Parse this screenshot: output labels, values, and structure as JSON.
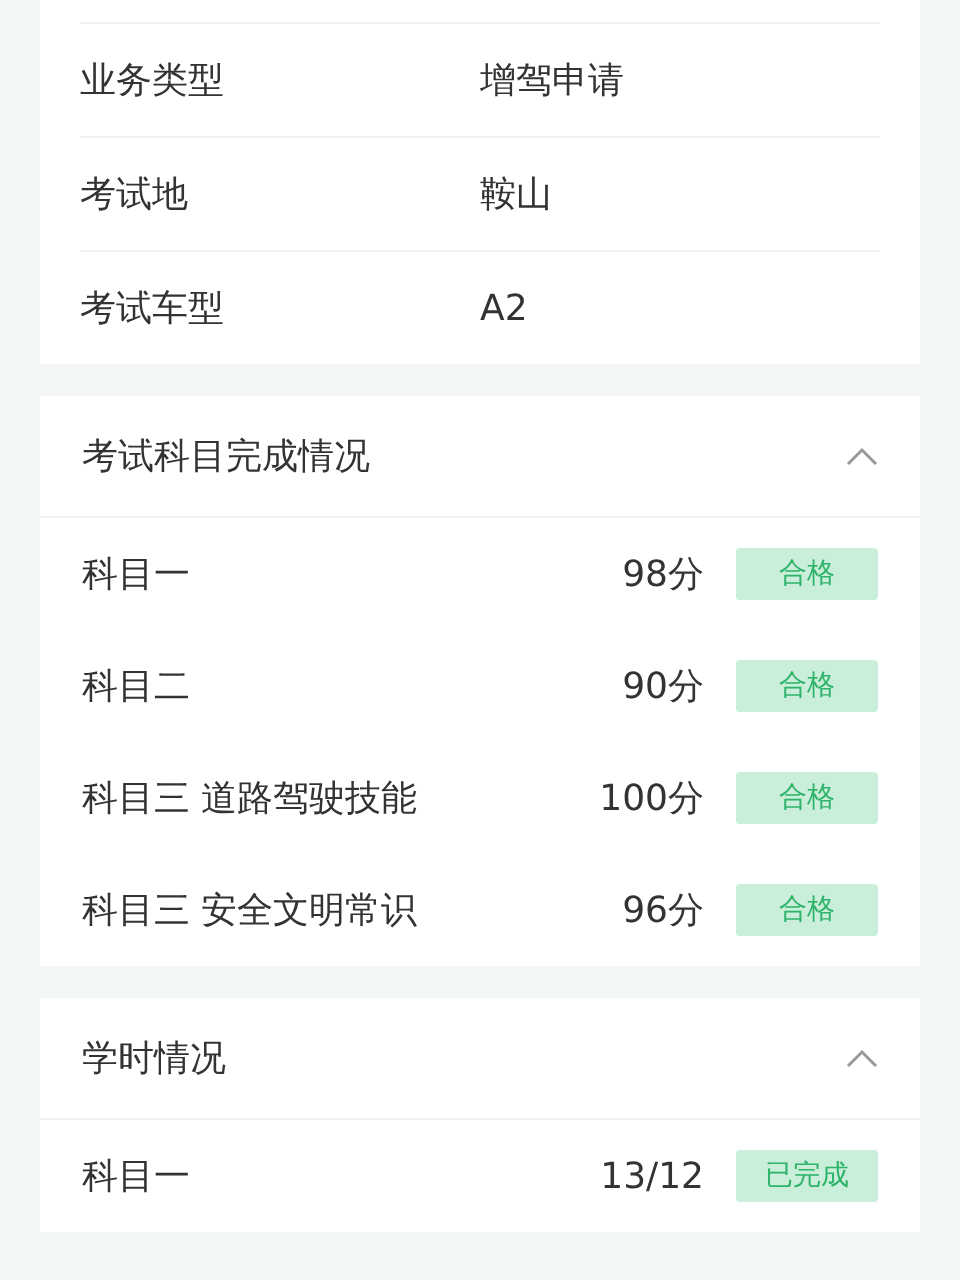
{
  "info": [
    {
      "label": "业务类型",
      "value": "增驾申请"
    },
    {
      "label": "考试地",
      "value": "鞍山"
    },
    {
      "label": "考试车型",
      "value": "A2"
    }
  ],
  "sections": [
    {
      "title": "考试科目完成情况",
      "expanded": true,
      "rows": [
        {
          "label": "科目一",
          "value": "98分",
          "status": "合格",
          "done": true
        },
        {
          "label": "科目二",
          "value": "90分",
          "status": "合格",
          "done": true
        },
        {
          "label": "科目三 道路驾驶技能",
          "value": "100分",
          "status": "合格",
          "done": true
        },
        {
          "label": "科目三 安全文明常识",
          "value": "96分",
          "status": "合格",
          "done": true
        }
      ]
    },
    {
      "title": "学时情况",
      "expanded": true,
      "rows": [
        {
          "label": "科目一",
          "value": "13/12",
          "status": "已完成",
          "done": true
        }
      ]
    }
  ]
}
